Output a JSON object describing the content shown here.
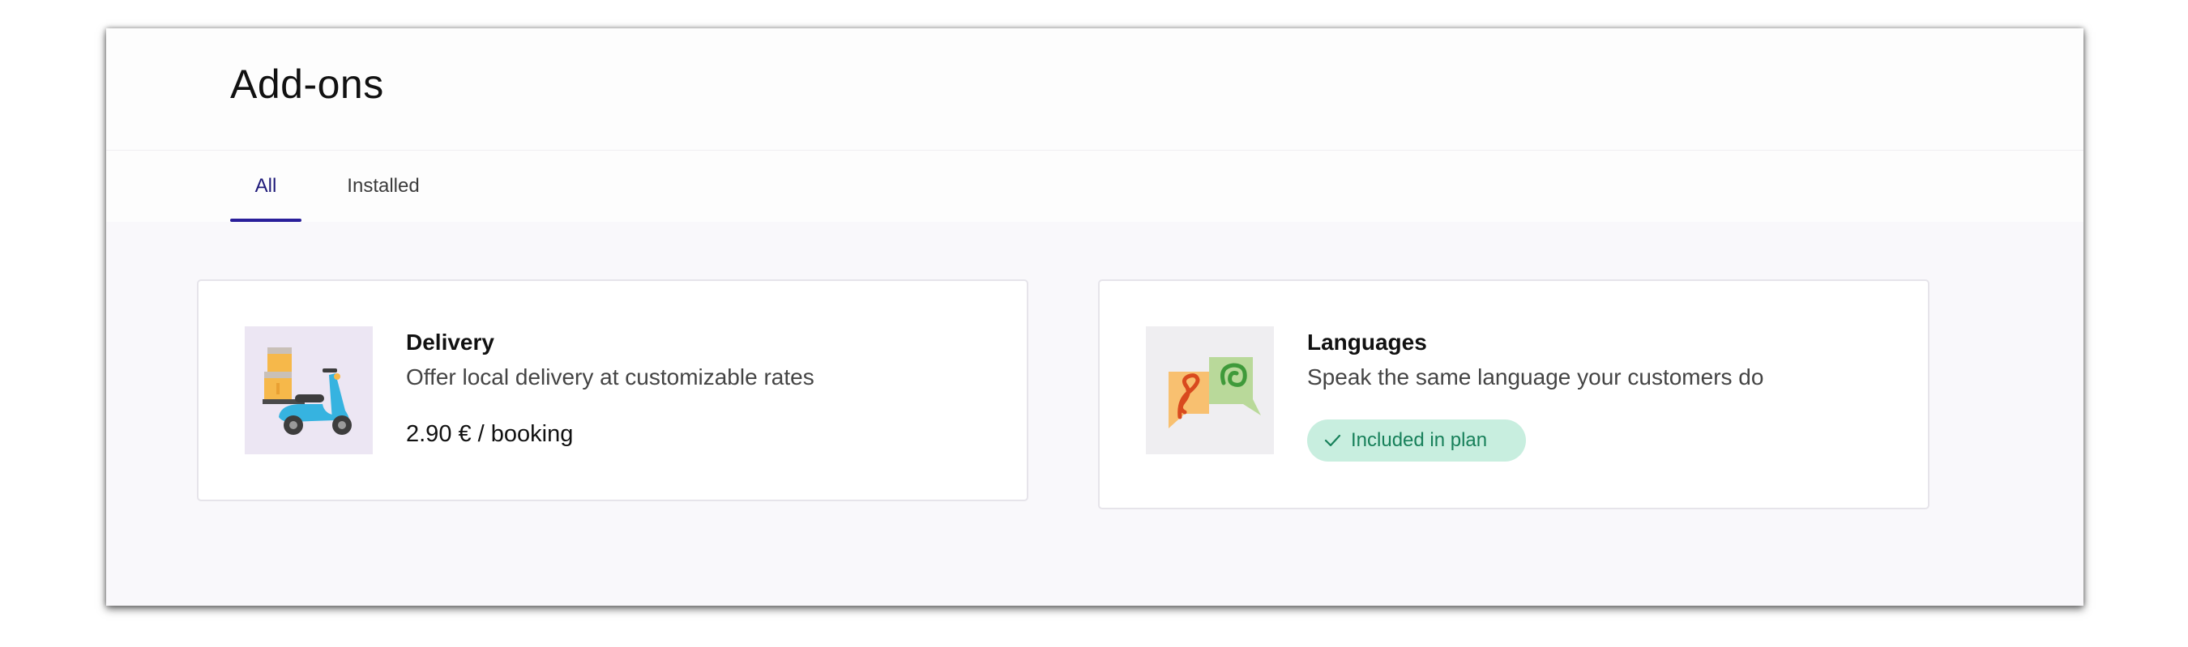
{
  "page": {
    "title": "Add-ons"
  },
  "tabs": [
    {
      "label": "All",
      "active": true
    },
    {
      "label": "Installed",
      "active": false
    }
  ],
  "addons": [
    {
      "name": "Delivery",
      "description": "Offer local delivery at customizable rates",
      "price": "2.90 € / booking",
      "icon": "scooter-delivery-icon"
    },
    {
      "name": "Languages",
      "description": "Speak the same language your customers do",
      "badge": "Included in plan",
      "icon": "speech-bubbles-icon"
    }
  ],
  "colors": {
    "accent": "#2a1f9a",
    "badge_bg": "#c8eedf",
    "badge_text": "#17805a"
  }
}
